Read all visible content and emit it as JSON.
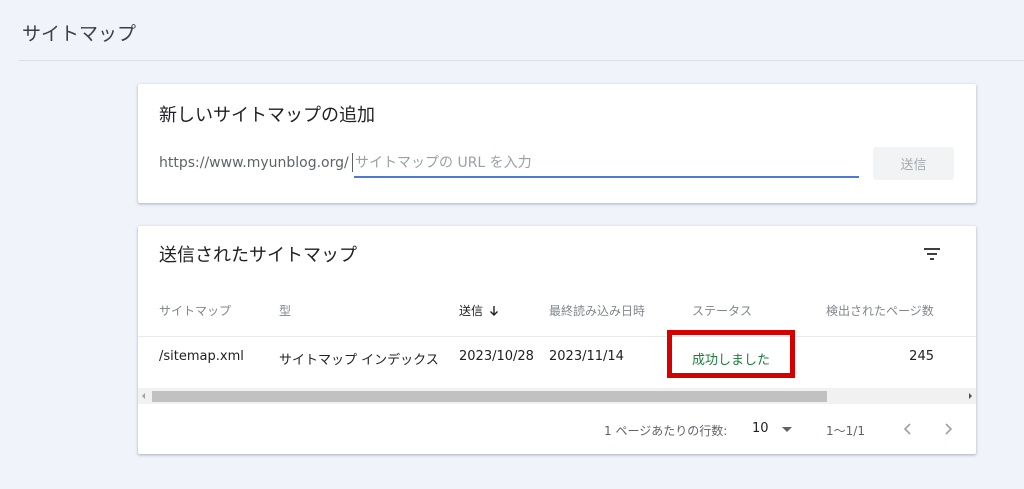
{
  "page_title": "サイトマップ",
  "add_card": {
    "title": "新しいサイトマップの追加",
    "url_prefix": "https://www.myunblog.org/",
    "input_placeholder": "サイトマップの URL を入力",
    "input_value": "",
    "submit_label": "送信"
  },
  "list_card": {
    "title": "送信されたサイトマップ",
    "filter_icon": "filter-icon",
    "columns": [
      "サイトマップ",
      "型",
      "送信",
      "最終読み込み日時",
      "ステータス",
      "検出されたページ数"
    ],
    "sorted_column": "送信",
    "sort_direction": "descending",
    "rows": [
      {
        "sitemap": "/sitemap.xml",
        "type": "サイトマップ インデックス",
        "submitted": "2023/10/28",
        "last_read": "2023/11/14",
        "status": "成功しました",
        "pages": "245"
      }
    ],
    "pagination": {
      "rows_per_page_label": "1 ページあたりの行数:",
      "rows_per_page": "10",
      "range": "1〜1/1"
    }
  },
  "colors": {
    "status_success": "#188038",
    "highlight": "#d50000",
    "input_focus": "#4a7dd0"
  }
}
